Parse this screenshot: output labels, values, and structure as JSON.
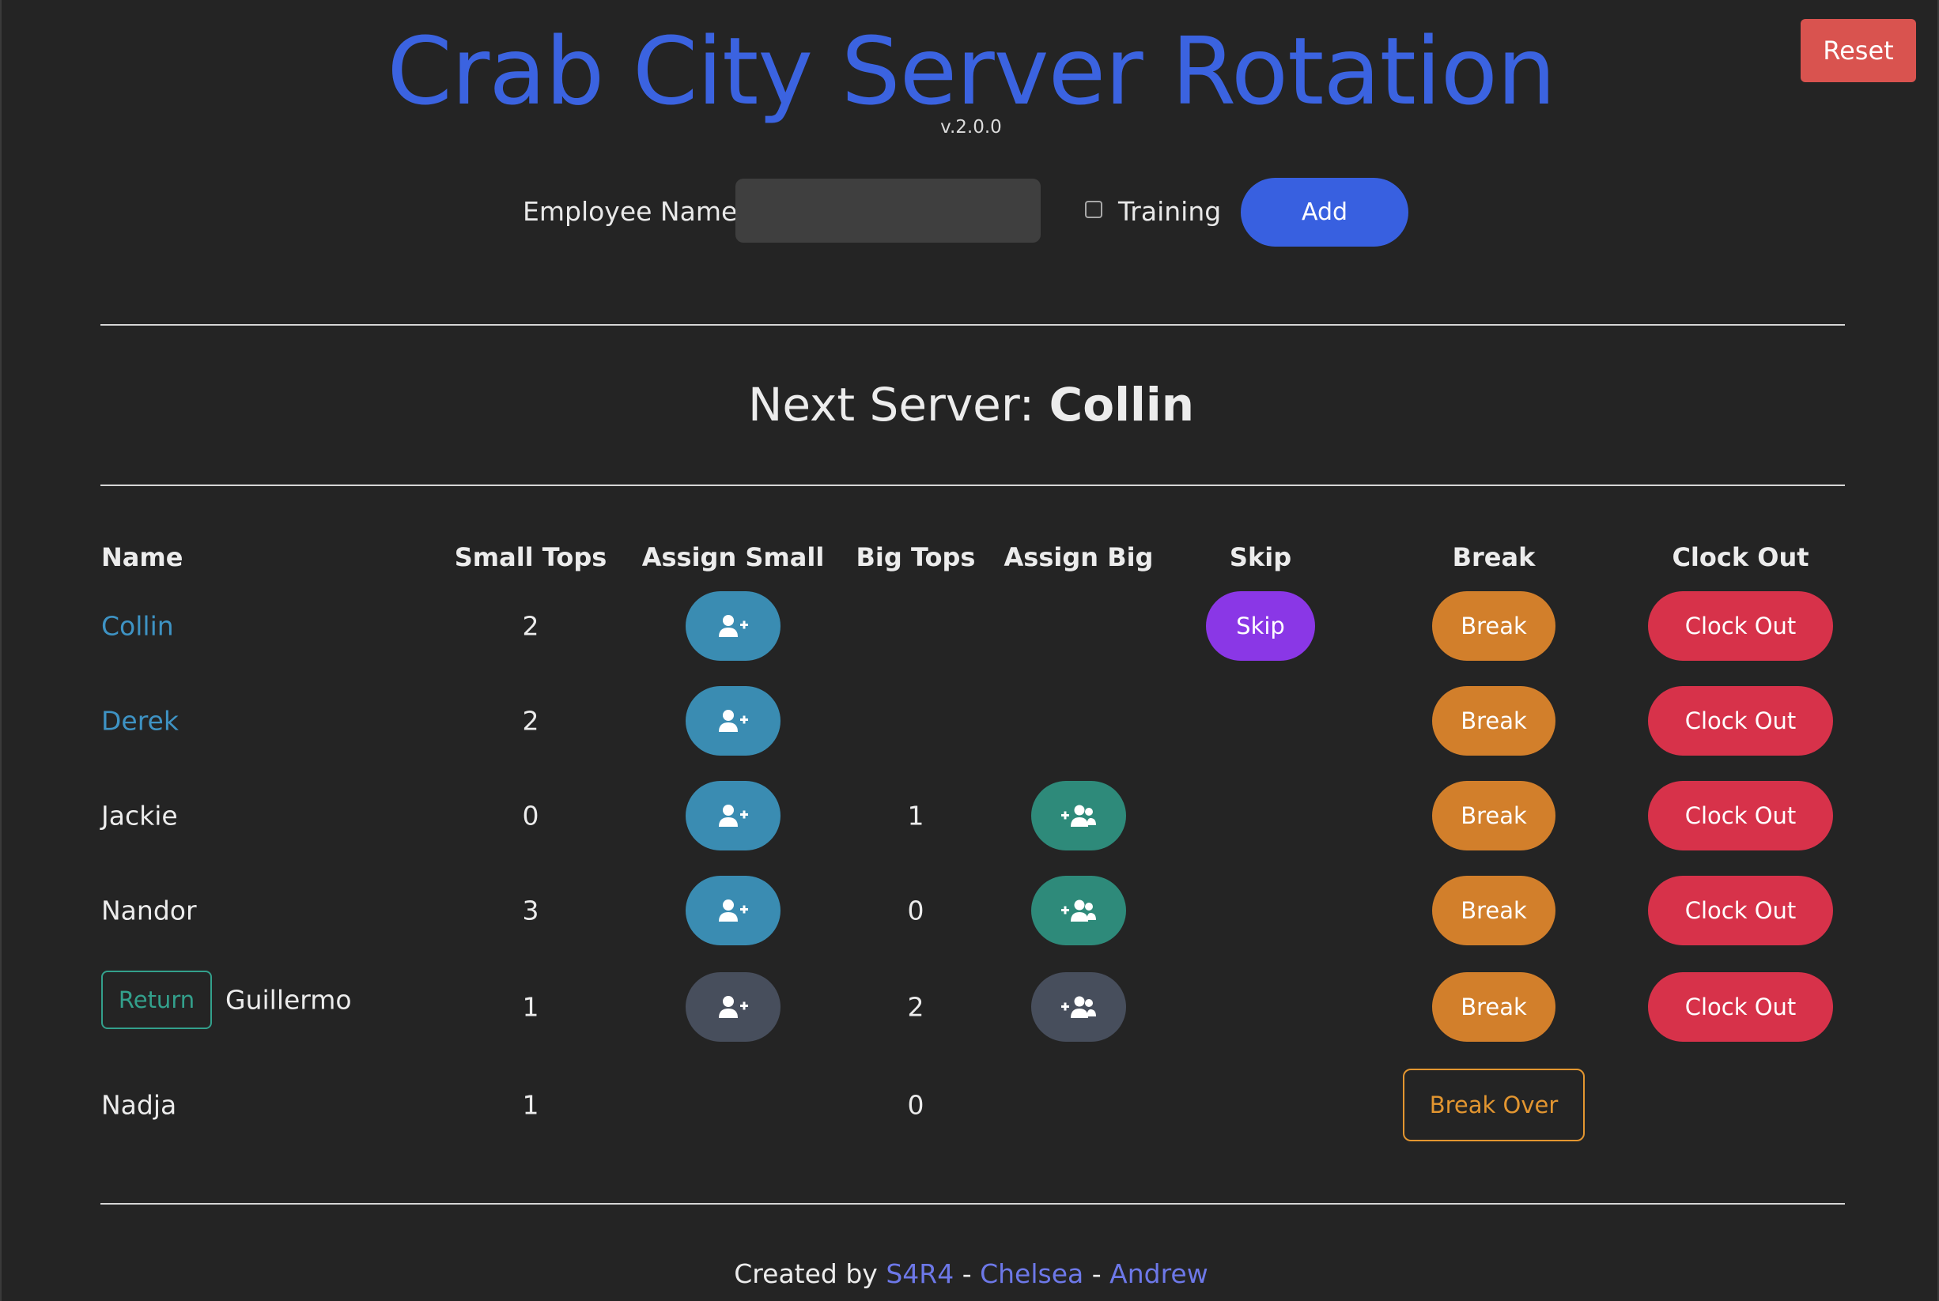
{
  "app": {
    "title": "Crab City Server Rotation",
    "version": "v.2.0.0",
    "reset_label": "Reset"
  },
  "form": {
    "employee_name_label": "Employee Name:",
    "employee_name_value": "",
    "training_label": "Training",
    "training_checked": false,
    "add_label": "Add"
  },
  "next_server": {
    "prefix": "Next Server: ",
    "name": "Collin"
  },
  "table": {
    "headers": {
      "name": "Name",
      "small_tops": "Small Tops",
      "assign_small": "Assign Small",
      "big_tops": "Big Tops",
      "assign_big": "Assign Big",
      "skip": "Skip",
      "break": "Break",
      "clock_out": "Clock Out"
    },
    "rows": [
      {
        "name": "Collin",
        "small_tops": "2",
        "big_tops": "",
        "skip_label": "Skip",
        "break_label": "Break",
        "clock_out_label": "Clock Out"
      },
      {
        "name": "Derek",
        "small_tops": "2",
        "big_tops": "",
        "break_label": "Break",
        "clock_out_label": "Clock Out"
      },
      {
        "name": "Jackie",
        "small_tops": "0",
        "big_tops": "1",
        "break_label": "Break",
        "clock_out_label": "Clock Out"
      },
      {
        "name": "Nandor",
        "small_tops": "3",
        "big_tops": "0",
        "break_label": "Break",
        "clock_out_label": "Clock Out"
      },
      {
        "name": "Guillermo",
        "return_label": "Return",
        "small_tops": "1",
        "big_tops": "2",
        "break_label": "Break",
        "clock_out_label": "Clock Out"
      },
      {
        "name": "Nadja",
        "small_tops": "1",
        "big_tops": "0",
        "break_over_label": "Break Over"
      }
    ]
  },
  "footer": {
    "prefix": "Created by ",
    "credits": [
      "S4R4",
      "Chelsea",
      "Andrew"
    ],
    "separator": " - "
  },
  "icons": {
    "assign_small": "user-plus-icon",
    "assign_big": "users-plus-icon"
  },
  "colors": {
    "title": "#3b63e0",
    "assign_small": "#3a8cb2",
    "assign_big": "#2e8a7a",
    "disabled": "#474e5c",
    "skip": "#8a37e6",
    "break": "#d27f2b",
    "clock_out": "#d7324a",
    "reset": "#d9534f",
    "return": "#33a08c",
    "break_over": "#e39630"
  }
}
